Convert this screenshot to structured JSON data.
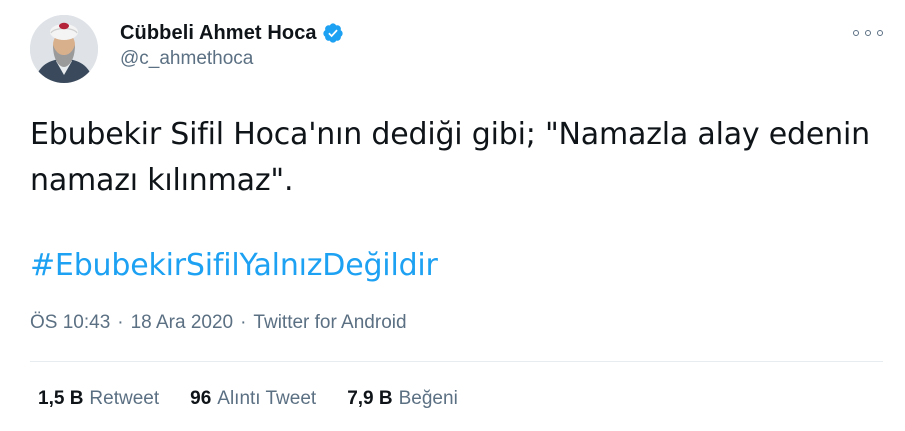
{
  "author": {
    "display_name": "Cübbeli Ahmet Hoca",
    "handle": "@c_ahmethoca",
    "verified": true
  },
  "tweet": {
    "text": "Ebubekir Sifil Hoca'nın dediği gibi; \"Namazla alay edenin namazı kılınmaz\".",
    "hashtag": "#EbubekirSifilYalnızDeğildir",
    "time": "ÖS 10:43",
    "date": "18 Ara 2020",
    "source": "Twitter for Android",
    "separator": "·"
  },
  "stats": [
    {
      "count": "1,5 B",
      "label": "Retweet"
    },
    {
      "count": "96",
      "label": "Alıntı Tweet"
    },
    {
      "count": "7,9 B",
      "label": "Beğeni"
    }
  ],
  "colors": {
    "link": "#1da1f2",
    "secondary_text": "#5b7083",
    "primary_text": "#0f1419"
  },
  "icons": {
    "verified": "verified-badge-icon",
    "more": "more-options-icon"
  }
}
